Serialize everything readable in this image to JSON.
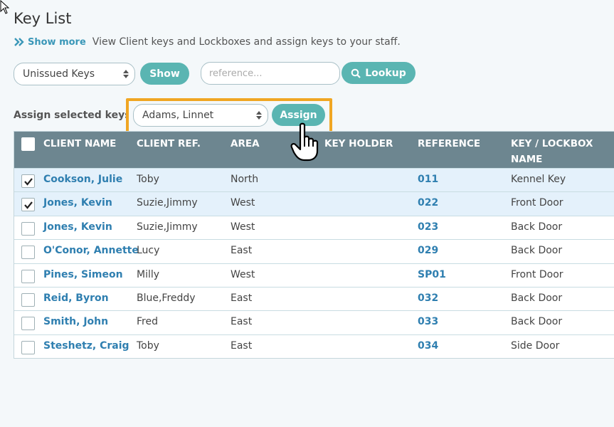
{
  "page": {
    "title": "Key List",
    "show_more": "Show more",
    "description": "View Client keys and Lockboxes and assign keys to your staff."
  },
  "filters": {
    "key_filter": "Unissued Keys",
    "show_label": "Show",
    "reference_placeholder": "reference...",
    "lookup_label": "Lookup"
  },
  "assign": {
    "label": "Assign selected keys to",
    "staff_selected": "Adams, Linnet",
    "assign_label": "Assign"
  },
  "table": {
    "columns": [
      "CLIENT NAME",
      "CLIENT REF.",
      "AREA",
      "KEY HOLDER",
      "REFERENCE",
      "KEY / LOCKBOX",
      "NAME"
    ],
    "rows": [
      {
        "checked": true,
        "client": "Cookson, Julie",
        "ref": "Toby",
        "area": "North",
        "holder": "",
        "reference": "011",
        "key": "Kennel Key"
      },
      {
        "checked": true,
        "client": "Jones, Kevin",
        "ref": "Suzie,Jimmy",
        "area": "West",
        "holder": "",
        "reference": "022",
        "key": "Front Door"
      },
      {
        "checked": false,
        "client": "Jones, Kevin",
        "ref": "Suzie,Jimmy",
        "area": "West",
        "holder": "",
        "reference": "023",
        "key": "Back Door"
      },
      {
        "checked": false,
        "client": "O'Conor, Annette",
        "ref": "Lucy",
        "area": "East",
        "holder": "",
        "reference": "029",
        "key": "Back Door"
      },
      {
        "checked": false,
        "client": "Pines, Simeon",
        "ref": "Milly",
        "area": "West",
        "holder": "",
        "reference": "SP01",
        "key": "Front Door"
      },
      {
        "checked": false,
        "client": "Reid, Byron",
        "ref": "Blue,Freddy",
        "area": "East",
        "holder": "",
        "reference": "032",
        "key": "Back Door"
      },
      {
        "checked": false,
        "client": "Smith, John",
        "ref": "Fred",
        "area": "East",
        "holder": "",
        "reference": "033",
        "key": "Back Door"
      },
      {
        "checked": false,
        "client": "Steshetz, Craig",
        "ref": "Toby",
        "area": "East",
        "holder": "",
        "reference": "034",
        "key": "Side Door"
      }
    ]
  },
  "colors": {
    "accent": "#5ab5b2",
    "header": "#6d8690",
    "link": "#2f7fb0",
    "highlight": "#f0a623",
    "selected_row": "#e4f1fb"
  }
}
